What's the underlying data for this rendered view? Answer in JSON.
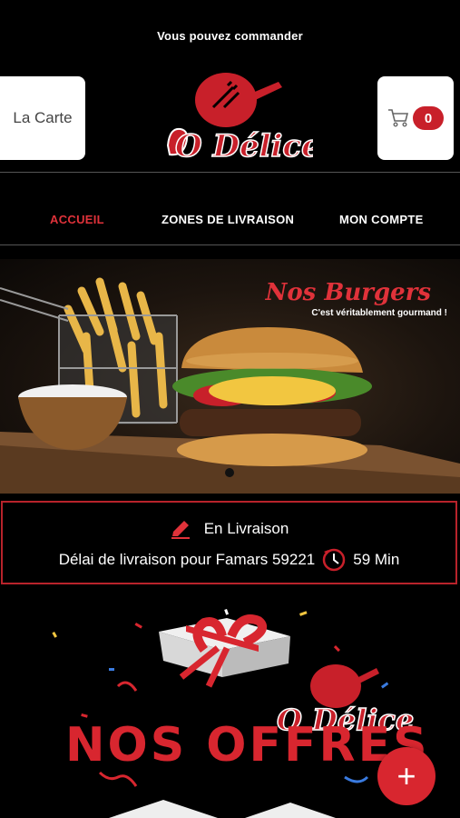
{
  "topbar": {
    "text": "Vous pouvez commander"
  },
  "header": {
    "carte_label": "La Carte",
    "cart_count": "0",
    "logo_text": "O Délice"
  },
  "nav": {
    "items": [
      {
        "label": "ACCUEIL",
        "active": true
      },
      {
        "label": "ZONES DE LIVRAISON",
        "active": false
      },
      {
        "label": "MON COMPTE",
        "active": false
      }
    ]
  },
  "banner": {
    "title": "Nos Burgers",
    "subtitle": "C'est véritablement gourmand !"
  },
  "delivery": {
    "mode": "En Livraison",
    "delay_text": "Délai de livraison pour Famars 59221",
    "time": "59 Min"
  },
  "offers": {
    "title": "NOS OFFRES",
    "logo_text": "O Délice"
  },
  "fab": {
    "label": "+"
  },
  "colors": {
    "accent": "#d8262f",
    "background": "#000000"
  }
}
